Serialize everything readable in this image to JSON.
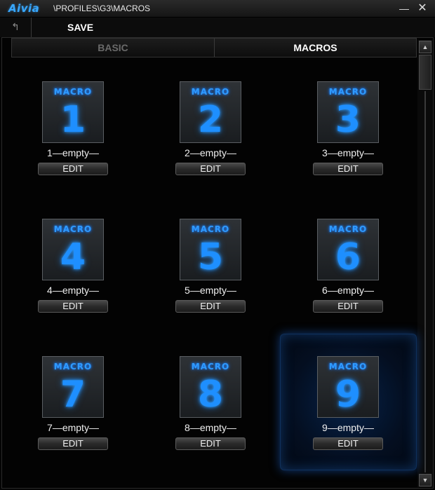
{
  "window": {
    "logo": "Aivia",
    "path": "\\PROFILES\\G3\\MACROS",
    "minimize": "—",
    "close": "✕"
  },
  "toolbar": {
    "back_icon": "↰",
    "save_label": "SAVE"
  },
  "tabs": [
    {
      "label": "BASIC",
      "active": false
    },
    {
      "label": "MACROS",
      "active": true
    }
  ],
  "macros": [
    {
      "word": "MACRO",
      "number": "1",
      "label": "1—empty—",
      "edit": "EDIT"
    },
    {
      "word": "MACRO",
      "number": "2",
      "label": "2—empty—",
      "edit": "EDIT"
    },
    {
      "word": "MACRO",
      "number": "3",
      "label": "3—empty—",
      "edit": "EDIT"
    },
    {
      "word": "MACRO",
      "number": "4",
      "label": "4—empty—",
      "edit": "EDIT"
    },
    {
      "word": "MACRO",
      "number": "5",
      "label": "5—empty—",
      "edit": "EDIT"
    },
    {
      "word": "MACRO",
      "number": "6",
      "label": "6—empty—",
      "edit": "EDIT"
    },
    {
      "word": "MACRO",
      "number": "7",
      "label": "7—empty—",
      "edit": "EDIT"
    },
    {
      "word": "MACRO",
      "number": "8",
      "label": "8—empty—",
      "edit": "EDIT"
    },
    {
      "word": "MACRO",
      "number": "9",
      "label": "9—empty—",
      "edit": "EDIT"
    }
  ],
  "selected_macro": 9,
  "scrollbar": {
    "up": "▲",
    "down": "▼"
  },
  "colors": {
    "accent": "#1e8fff",
    "logo": "#38a8ff",
    "background": "#050505"
  }
}
